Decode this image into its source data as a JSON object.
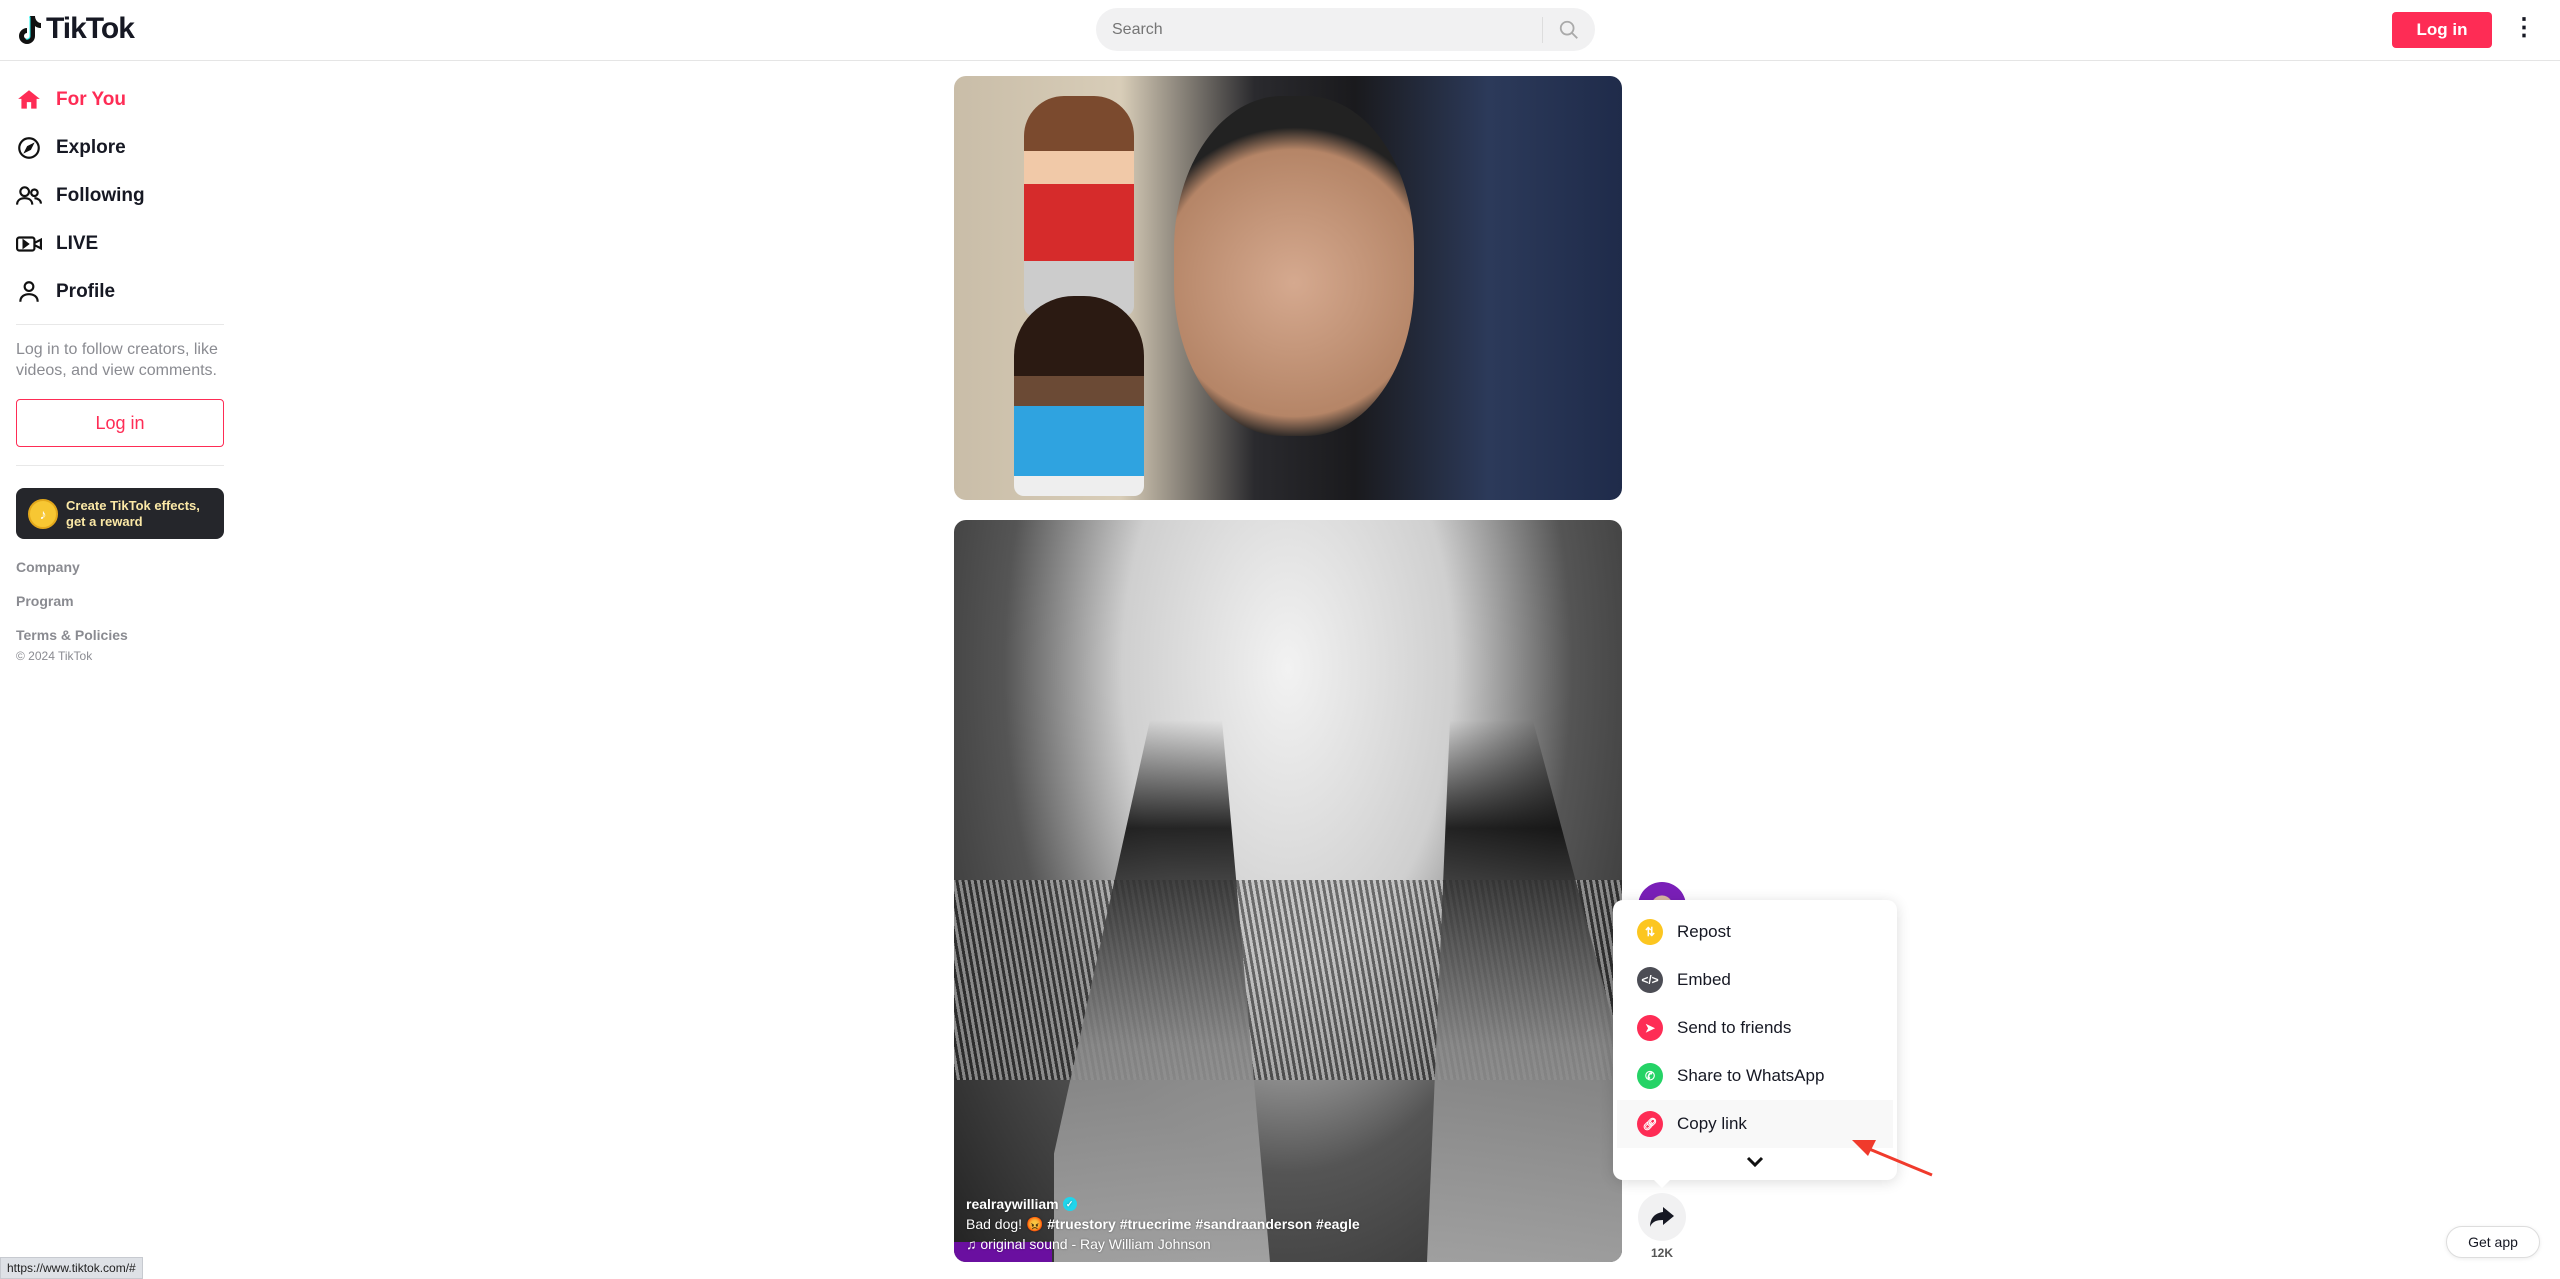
{
  "header": {
    "logo": "TikTok",
    "search_placeholder": "Search",
    "login": "Log in"
  },
  "sidebar": {
    "items": [
      {
        "label": "For You",
        "icon": "home-icon",
        "active": true
      },
      {
        "label": "Explore",
        "icon": "compass-icon"
      },
      {
        "label": "Following",
        "icon": "users-icon"
      },
      {
        "label": "LIVE",
        "icon": "live-video-icon"
      },
      {
        "label": "Profile",
        "icon": "user-icon"
      }
    ],
    "hint": "Log in to follow creators, like videos, and view comments.",
    "login": "Log in",
    "effects_line1": "Create TikTok effects,",
    "effects_line2": "get a reward",
    "links": [
      "Company",
      "Program",
      "Terms & Policies"
    ],
    "copyright": "© 2024 TikTok"
  },
  "video2": {
    "username": "realraywilliam",
    "description": "Bad dog! 😡",
    "hashtags": [
      "#truestory",
      "#truecrime",
      "#sandraanderson",
      "#eagle"
    ],
    "sound": "original sound - Ray William Johnson"
  },
  "share_menu": {
    "items": [
      {
        "label": "Repost",
        "color": "#fcc620"
      },
      {
        "label": "Embed",
        "color": "#4c4d55"
      },
      {
        "label": "Send to friends",
        "color": "#fe2c55"
      },
      {
        "label": "Share to WhatsApp",
        "color": "#25d366"
      },
      {
        "label": "Copy link",
        "color": "#fe2c55"
      }
    ]
  },
  "share_count": "12K",
  "get_app": "Get app",
  "status_url": "https://www.tiktok.com/#",
  "colors": {
    "accent": "#fe2c55"
  }
}
